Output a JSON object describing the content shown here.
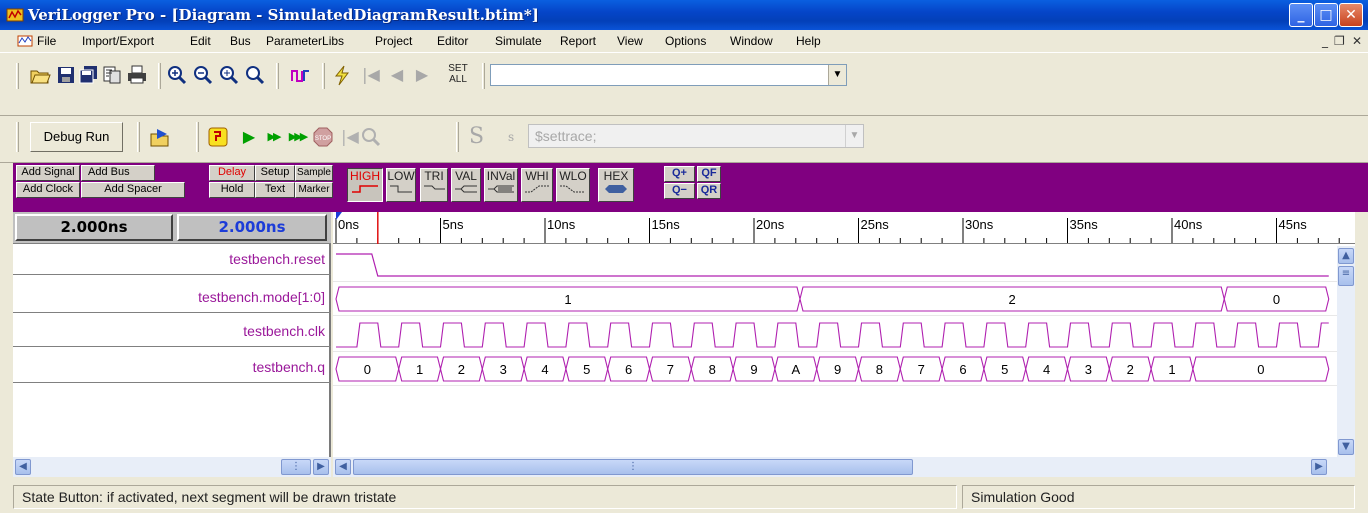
{
  "window": {
    "title": "VeriLogger Pro - [Diagram - SimulatedDiagramResult.btim*]"
  },
  "menu": [
    "File",
    "Import/Export",
    "Edit",
    "Bus",
    "ParameterLibs",
    "Project",
    "Editor",
    "Simulate",
    "Report",
    "View",
    "Options",
    "Window",
    "Help"
  ],
  "toolbar": {
    "set_all_line1": "SET",
    "set_all_line2": "ALL",
    "combo_value": "",
    "debug_run": "Debug Run",
    "s_glyph": "S",
    "s_small": "s",
    "trace_value": "$settrace;"
  },
  "sigbar": {
    "add_signal": "Add Signal",
    "add_bus": "Add Bus",
    "add_clock": "Add Clock",
    "add_spacer": "Add Spacer",
    "delay": "Delay",
    "setup": "Setup",
    "sample": "Sample",
    "hold": "Hold",
    "text": "Text",
    "marker": "Marker",
    "high": "HIGH",
    "low": "LOW",
    "tri": "TRI",
    "val": "VAL",
    "inval": "INVal",
    "whi": "WHI",
    "wlo": "WLO",
    "hex": "HEX",
    "zoom_in": "Q+",
    "zoom_full": "QF",
    "zoom_out": "Q−",
    "zoom_range": "QR"
  },
  "time": {
    "cursor1": "2.000ns",
    "cursor2": "2.000ns",
    "cursor2_color": "#1c3cd8",
    "ticks": [
      "0ns",
      "5ns",
      "10ns",
      "15ns",
      "20ns",
      "25ns",
      "30ns",
      "35ns",
      "40ns",
      "45ns"
    ]
  },
  "signals": [
    {
      "name": "testbench.reset"
    },
    {
      "name": "testbench.mode[1:0]"
    },
    {
      "name": "testbench.clk"
    },
    {
      "name": "testbench.q"
    }
  ],
  "waves": {
    "reset": {
      "high_from_ns": 0,
      "high_to_ns": 2
    },
    "mode": [
      {
        "from": 0,
        "to": 22.2,
        "value": "1"
      },
      {
        "from": 22.2,
        "to": 42.5,
        "value": "2"
      },
      {
        "from": 42.5,
        "to": 47.5,
        "value": "0"
      }
    ],
    "clk_period_ns": 2,
    "q": [
      {
        "from": 0,
        "to": 3,
        "value": "0"
      },
      {
        "from": 3,
        "to": 5,
        "value": "1"
      },
      {
        "from": 5,
        "to": 7,
        "value": "2"
      },
      {
        "from": 7,
        "to": 9,
        "value": "3"
      },
      {
        "from": 9,
        "to": 11,
        "value": "4"
      },
      {
        "from": 11,
        "to": 13,
        "value": "5"
      },
      {
        "from": 13,
        "to": 15,
        "value": "6"
      },
      {
        "from": 15,
        "to": 17,
        "value": "7"
      },
      {
        "from": 17,
        "to": 19,
        "value": "8"
      },
      {
        "from": 19,
        "to": 21,
        "value": "9"
      },
      {
        "from": 21,
        "to": 23,
        "value": "A"
      },
      {
        "from": 23,
        "to": 25,
        "value": "9"
      },
      {
        "from": 25,
        "to": 27,
        "value": "8"
      },
      {
        "from": 27,
        "to": 29,
        "value": "7"
      },
      {
        "from": 29,
        "to": 31,
        "value": "6"
      },
      {
        "from": 31,
        "to": 33,
        "value": "5"
      },
      {
        "from": 33,
        "to": 35,
        "value": "4"
      },
      {
        "from": 35,
        "to": 37,
        "value": "3"
      },
      {
        "from": 37,
        "to": 39,
        "value": "2"
      },
      {
        "from": 39,
        "to": 41,
        "value": "1"
      },
      {
        "from": 41,
        "to": 47.5,
        "value": "0"
      }
    ],
    "cursor_ns": 2,
    "wave_color": "#b020b0",
    "cursor_color": "#e01010"
  },
  "status": {
    "message": "State Button: if activated, next segment will be drawn tristate",
    "simulation": "Simulation Good"
  }
}
